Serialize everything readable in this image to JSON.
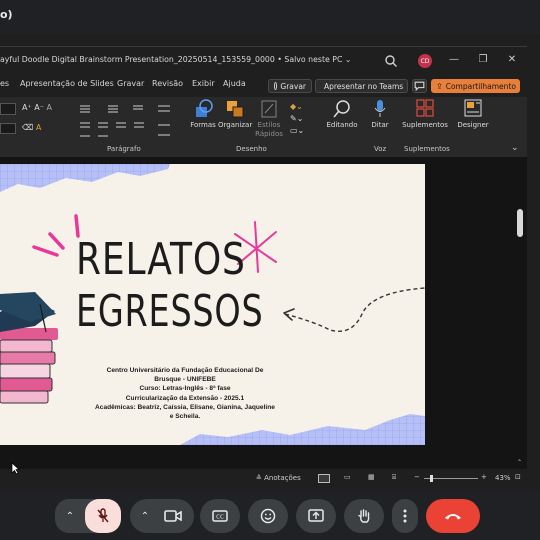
{
  "meet": {
    "title": "o)"
  },
  "window": {
    "doc_title": "ayful Doodle Digital Brainstorm Presentation_20250514_153559_0000 • Salvo neste PC ⌄",
    "avatar_initials": "CD",
    "controls": [
      "—",
      "❐",
      "✕"
    ]
  },
  "menu": {
    "items": [
      "es",
      "Apresentação de Slides",
      "Gravar",
      "Revisão",
      "Exibir",
      "Ajuda"
    ],
    "record_label": "Gravar",
    "teams_label": "Apresentar no Teams",
    "share_label": "Compartilhamento ⌄"
  },
  "ribbon": {
    "groups": {
      "paragraph": "Parágrafo",
      "drawing": "Desenho",
      "voice": "Voz",
      "addins": "Suplementos"
    },
    "buttons": {
      "shapes": "Formas",
      "arrange": "Organizar",
      "styles1": "Estilos",
      "styles2": "Rápidos",
      "editing": "Editando",
      "dictate": "Ditar",
      "addins": "Suplementos",
      "designer": "Designer"
    }
  },
  "slide": {
    "title_line1": "RELATOS",
    "title_line2": "EGRESSOS",
    "info": [
      "Centro Universitário da Fundação Educacional De",
      "Brusque - UNIFEBE",
      "Curso: Letras-Inglês - 8ª fase",
      "Curricularização da Extensão - 2025.1",
      "Acadêmicas: Beatriz, Caíssia, Elisane, Gianina, Jaqueline",
      "e Scheila."
    ]
  },
  "status": {
    "notes_label": "Anotações",
    "zoom": "43%"
  },
  "colors": {
    "accent_orange": "#e87f3a",
    "end_call": "#ea4335",
    "mic_off_bg": "#f9dedc",
    "grid_blue": "#a9b4f5",
    "pink": "#e8399a"
  }
}
